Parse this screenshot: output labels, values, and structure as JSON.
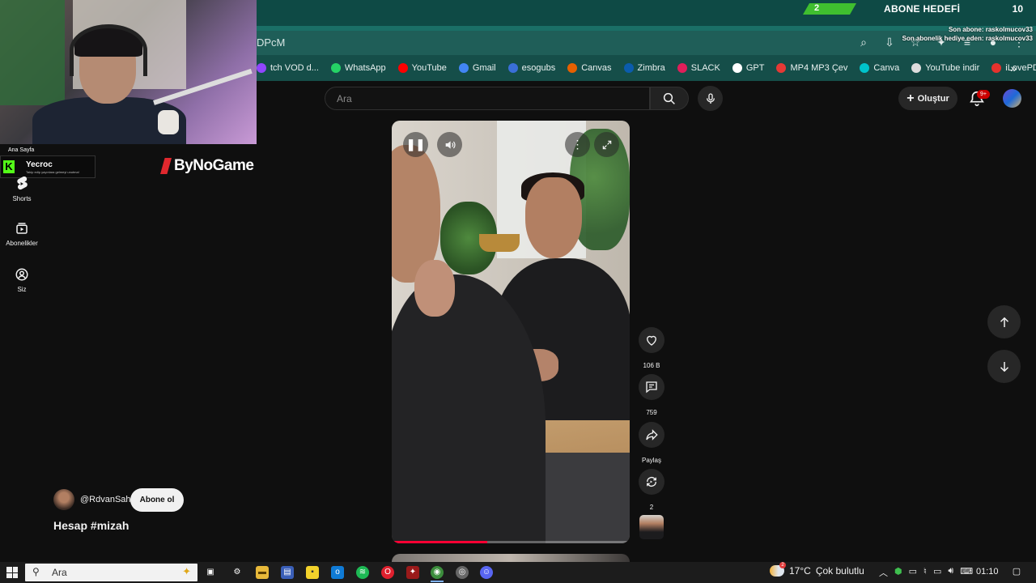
{
  "browser": {
    "url_fragment": "DPcM",
    "bookmarks": [
      {
        "label": "tch VOD d...",
        "icon": "twitch-icon",
        "color": "#9146ff"
      },
      {
        "label": "WhatsApp",
        "icon": "whatsapp-icon",
        "color": "#25d366"
      },
      {
        "label": "YouTube",
        "icon": "youtube-icon",
        "color": "#ff0000"
      },
      {
        "label": "Gmail",
        "icon": "google-icon",
        "color": "#4285f4"
      },
      {
        "label": "esogubs",
        "icon": "globe-icon",
        "color": "#3a6fd8"
      },
      {
        "label": "Canvas",
        "icon": "canvas-icon",
        "color": "#e66000"
      },
      {
        "label": "Zimbra",
        "icon": "zimbra-icon",
        "color": "#0b5cad"
      },
      {
        "label": "SLACK",
        "icon": "slack-icon",
        "color": "#e01e5a"
      },
      {
        "label": "GPT",
        "icon": "openai-icon",
        "color": "#ffffff"
      },
      {
        "label": "MP4 MP3 Çev",
        "icon": "converter-icon",
        "color": "#e53935"
      },
      {
        "label": "Canva",
        "icon": "canva-icon",
        "color": "#00c4cc"
      },
      {
        "label": "YouTube indir",
        "icon": "globe-icon",
        "color": "#dddddd"
      },
      {
        "label": "iLovePDF",
        "icon": "ilovepdf-icon",
        "color": "#e5322d"
      }
    ]
  },
  "overlay": {
    "goal_current": "2",
    "goal_label": "ABONE HEDEFİ",
    "goal_max": "10",
    "goal_progress": 0.2,
    "last_sub": "Son abone: raskolmucov33",
    "last_gift": "Son abonelik hediye eden: raskolmucov33",
    "chat_user": "Yecroc",
    "chat_sub": "Takip edip yayınlara gelmeyi unutma!",
    "sponsor": "ByNoGame",
    "nav_home_label": "Ana Sayfa"
  },
  "youtube": {
    "search_placeholder": "Ara",
    "create_label": "Oluştur",
    "notifications_badge": "9+",
    "nav": [
      {
        "label": "Shorts",
        "icon": "shorts-icon"
      },
      {
        "label": "Abonelikler",
        "icon": "subscriptions-icon"
      },
      {
        "label": "Siz",
        "icon": "user-icon"
      }
    ],
    "actions": {
      "like_count": "106 B",
      "comment_count": "759",
      "share_label": "Paylaş",
      "remix_count": "2"
    },
    "channel": {
      "handle": "@RdvanSah",
      "subscribe_label": "Abone ol",
      "title": "Hesap #mizah"
    },
    "video_progress": 0.4,
    "accent_color": "#ff0033"
  },
  "taskbar": {
    "search_placeholder": "Ara",
    "weather_temp": "17°C",
    "weather_desc": "Çok bulutlu",
    "weather_badge": "2",
    "time": "01:10"
  }
}
